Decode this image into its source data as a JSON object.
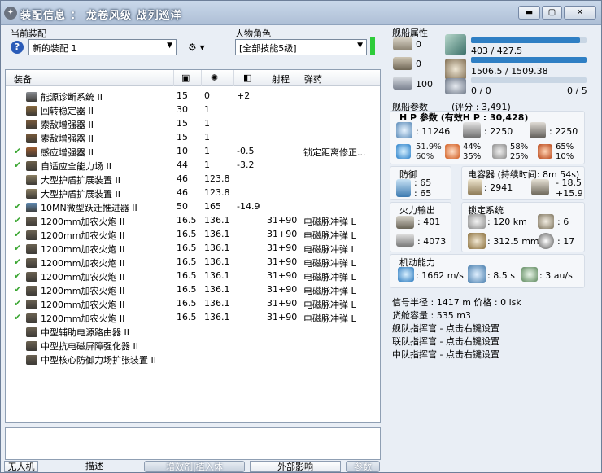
{
  "title": {
    "icon": "eve-logo-icon",
    "text": "装配信息 ： 龙卷风级  战列巡洋"
  },
  "window_buttons": {
    "minimize": "▬",
    "maximize": "▢",
    "close": "✕"
  },
  "left": {
    "fit_label": "当前装配",
    "fit_value": "新的装配 1",
    "character_label": "人物角色",
    "character_value": "[全部技能5级]"
  },
  "grid": {
    "headers": {
      "name": "装备",
      "range": "射程",
      "ammo": "弹药"
    },
    "rows": [
      {
        "check": "",
        "name": "能源诊断系统 II",
        "c1": "15",
        "c2": "0",
        "c3": "+2",
        "range": "",
        "ammo": ""
      },
      {
        "check": "",
        "name": "回转稳定器 II",
        "c1": "30",
        "c2": "1",
        "c3": "",
        "range": "",
        "ammo": ""
      },
      {
        "check": "",
        "name": "索敌增强器 II",
        "c1": "15",
        "c2": "1",
        "c3": "",
        "range": "",
        "ammo": ""
      },
      {
        "check": "",
        "name": "索敌增强器 II",
        "c1": "15",
        "c2": "1",
        "c3": "",
        "range": "",
        "ammo": ""
      },
      {
        "check": "✔",
        "name": "感应增强器 II",
        "c1": "10",
        "c2": "1",
        "c3": "-0.5",
        "range": "",
        "ammo": "锁定距离修正..."
      },
      {
        "check": "✔",
        "name": "自适应全能力场 II",
        "c1": "44",
        "c2": "1",
        "c3": "-3.2",
        "range": "",
        "ammo": ""
      },
      {
        "check": "",
        "name": "大型护盾扩展装置 II",
        "c1": "46",
        "c2": "123.8",
        "c3": "",
        "range": "",
        "ammo": ""
      },
      {
        "check": "",
        "name": "大型护盾扩展装置 II",
        "c1": "46",
        "c2": "123.8",
        "c3": "",
        "range": "",
        "ammo": ""
      },
      {
        "check": "✔",
        "name": "10MN微型跃迁推进器 II",
        "c1": "50",
        "c2": "165",
        "c3": "-14.9",
        "range": "",
        "ammo": ""
      },
      {
        "check": "✔",
        "name": "1200mm加农火炮 II",
        "c1": "16.5",
        "c2": "136.1",
        "c3": "",
        "range": "31+90",
        "ammo": "电磁脉冲弹 L"
      },
      {
        "check": "✔",
        "name": "1200mm加农火炮 II",
        "c1": "16.5",
        "c2": "136.1",
        "c3": "",
        "range": "31+90",
        "ammo": "电磁脉冲弹 L"
      },
      {
        "check": "✔",
        "name": "1200mm加农火炮 II",
        "c1": "16.5",
        "c2": "136.1",
        "c3": "",
        "range": "31+90",
        "ammo": "电磁脉冲弹 L"
      },
      {
        "check": "✔",
        "name": "1200mm加农火炮 II",
        "c1": "16.5",
        "c2": "136.1",
        "c3": "",
        "range": "31+90",
        "ammo": "电磁脉冲弹 L"
      },
      {
        "check": "✔",
        "name": "1200mm加农火炮 II",
        "c1": "16.5",
        "c2": "136.1",
        "c3": "",
        "range": "31+90",
        "ammo": "电磁脉冲弹 L"
      },
      {
        "check": "✔",
        "name": "1200mm加农火炮 II",
        "c1": "16.5",
        "c2": "136.1",
        "c3": "",
        "range": "31+90",
        "ammo": "电磁脉冲弹 L"
      },
      {
        "check": "✔",
        "name": "1200mm加农火炮 II",
        "c1": "16.5",
        "c2": "136.1",
        "c3": "",
        "range": "31+90",
        "ammo": "电磁脉冲弹 L"
      },
      {
        "check": "✔",
        "name": "1200mm加农火炮 II",
        "c1": "16.5",
        "c2": "136.1",
        "c3": "",
        "range": "31+90",
        "ammo": "电磁脉冲弹 L"
      },
      {
        "check": "",
        "name": "中型辅助电源路由器 II",
        "c1": "",
        "c2": "",
        "c3": "",
        "range": "",
        "ammo": ""
      },
      {
        "check": "",
        "name": "中型抗电磁屏障强化器 II",
        "c1": "",
        "c2": "",
        "c3": "",
        "range": "",
        "ammo": ""
      },
      {
        "check": "",
        "name": "中型核心防御力场扩张装置 II",
        "c1": "",
        "c2": "",
        "c3": "",
        "range": "",
        "ammo": ""
      }
    ]
  },
  "tabs": [
    "无人机",
    "描述",
    "增效剂|植入体",
    "外部影响",
    "参数"
  ],
  "attrs": {
    "title": "舰船属性",
    "hardpoints": [
      "0",
      "0",
      "100"
    ],
    "cpu": "403 / 427.5",
    "cpu_fill": 0.943,
    "power": "1506.5 / 1509.38",
    "power_fill": 0.998,
    "calib": "0 / 0",
    "calib_count": "0 / 5"
  },
  "params": {
    "title": "舰船参数",
    "score": "(评分 : 3,491)",
    "hp_label": "H P 参数 (有效H P :   30,428)",
    "hp_shield": ": 11246",
    "hp_armor": ": 2250",
    "hp_hull": ": 2250",
    "res": [
      [
        "51.9%",
        "60%"
      ],
      [
        "44%",
        "35%"
      ],
      [
        "58%",
        "25%"
      ],
      [
        "65%",
        "10%"
      ]
    ],
    "defense_label": "防御",
    "defense_1": ": 65",
    "defense_2": ": 65",
    "cap_label": "电容器 (持续时间: 8m 54s)",
    "cap_value": ": 2941",
    "cap_delta_1": "- 18.5",
    "cap_delta_2": "+15.9",
    "fire_label": "火力输出",
    "fire_1": ": 401",
    "fire_2": ": 4073",
    "lock_label": "锁定系统",
    "lock_range": ": 120 km",
    "lock_targets": ": 6",
    "lock_res": ": 312.5 mm",
    "lock_sensor": ": 17",
    "move_label": "机动能力",
    "speed": ": 1662 m/s",
    "align": ": 8.5 s",
    "warp": ": 3 au/s",
    "sig": "信号半径 : 1417 m    价格 : 0 isk",
    "cargo": "货舱容量 : 535 m3",
    "fleet_cmd": "舰队指挥官 - 点击右键设置",
    "wing_cmd": "联队指挥官 - 点击右键设置",
    "squad_cmd": "中队指挥官 - 点击右键设置"
  },
  "colors": {
    "bar": "#2f7fc4",
    "accent": "#3aa631",
    "green_slot": "#2ecc3a"
  }
}
